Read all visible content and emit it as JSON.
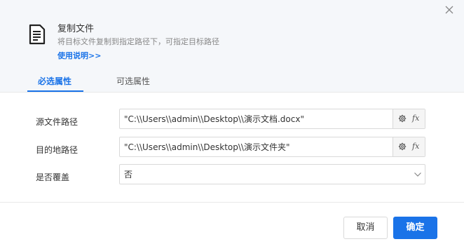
{
  "header": {
    "title": "复制文件",
    "description": "将目标文件复制到指定路径下，可指定目标路径",
    "help_link": "使用说明>>",
    "icon": "document-icon",
    "close_icon": "close-icon"
  },
  "tabs": [
    {
      "label": "必选属性",
      "active": true
    },
    {
      "label": "可选属性",
      "active": false
    }
  ],
  "form": {
    "source": {
      "label": "源文件路径",
      "value": "\"C:\\\\Users\\\\admin\\\\Desktop\\\\演示文档.docx\""
    },
    "destination": {
      "label": "目的地路径",
      "value": "\"C:\\\\Users\\\\admin\\\\Desktop\\\\演示文件夹\""
    },
    "overwrite": {
      "label": "是否覆盖",
      "value": "否"
    },
    "fx_label": "fx"
  },
  "footer": {
    "cancel_label": "取消",
    "ok_label": "确定"
  },
  "colors": {
    "accent": "#1a73e8",
    "header_bg": "#f5f7fa"
  }
}
